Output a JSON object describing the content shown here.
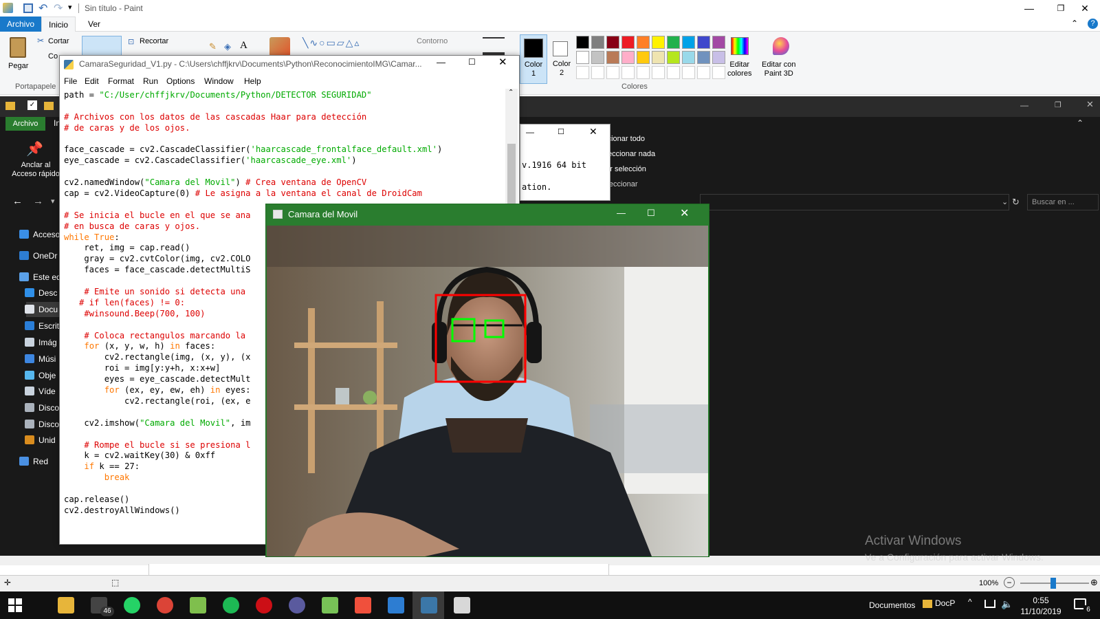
{
  "paint": {
    "title": "Sin título - Paint",
    "tabs": [
      "Archivo",
      "Inicio",
      "Ver"
    ],
    "clipboard": {
      "paste": "Pegar",
      "cut": "Cortar",
      "copy": "Co",
      "group": "Portapapele"
    },
    "image": {
      "crop": "Recortar"
    },
    "shapes": {
      "outline": "Contorno"
    },
    "color1": "Color\n1",
    "color2": "Color\n2",
    "colors_group": "Colores",
    "edit_colors": "Editar\ncolores",
    "paint3d": "Editar con\nPaint 3D",
    "palette_row1": [
      "#000000",
      "#7f7f7f",
      "#880015",
      "#ed1c24",
      "#ff7f27",
      "#fff200",
      "#22b14c",
      "#00a2e8",
      "#3f48cc",
      "#a349a4"
    ],
    "palette_row2": [
      "#ffffff",
      "#c3c3c3",
      "#b97a57",
      "#ffaec9",
      "#ffc90e",
      "#efe4b0",
      "#b5e61d",
      "#99d9ea",
      "#7092be",
      "#c8bfe7"
    ],
    "zoom": "100%"
  },
  "explorer": {
    "tab_archivo": "Archivo",
    "tab_in": "In",
    "pin_label": "Anclar al\nAcceso rápido",
    "select_all": "eccionar todo",
    "select_none": "seleccionar nada",
    "invert_selection": "ertir selección",
    "select_group": "Seleccionar",
    "search_placeholder": "Buscar en ...",
    "nav": [
      {
        "label": "Acceso",
        "color": "#3a8ee6"
      },
      {
        "label": "OneDr",
        "color": "#2d7dd2"
      },
      {
        "label": "Este eq",
        "color": "#5aa0e8"
      },
      {
        "label": "Desc",
        "color": "#2f8fe8"
      },
      {
        "label": "Docu",
        "color": "#dfe3ea"
      },
      {
        "label": "Escrit",
        "color": "#2a7ed8"
      },
      {
        "label": "Imág",
        "color": "#c9d3de"
      },
      {
        "label": "Músi",
        "color": "#3d86e0"
      },
      {
        "label": "Obje",
        "color": "#56b7ee"
      },
      {
        "label": "Víde",
        "color": "#c9d3de"
      },
      {
        "label": "Disco",
        "color": "#aab2bc"
      },
      {
        "label": "Disco",
        "color": "#aab2bc"
      },
      {
        "label": "Unid",
        "color": "#d98c1e"
      },
      {
        "label": "Red",
        "color": "#4a90e2"
      }
    ]
  },
  "python_shell": {
    "version_text": "v.1916 64 bit",
    "ation_text": "ation."
  },
  "idle": {
    "title": "CamaraSeguridad_V1.py - C:\\Users\\chffjkrv\\Documents\\Python\\ReconocimientoIMG\\Camar...",
    "menu": [
      "File",
      "Edit",
      "Format",
      "Run",
      "Options",
      "Window",
      "Help"
    ],
    "code": [
      [
        [
          "",
          "path = "
        ],
        [
          "st",
          "\"C:/User/chffjkrv/Documents/Python/DETECTOR SEGURIDAD\""
        ]
      ],
      [],
      [
        [
          "cm",
          "# Archivos con los datos de las cascadas Haar para detección"
        ]
      ],
      [
        [
          "cm",
          "# de caras y de los ojos."
        ]
      ],
      [],
      [
        [
          "",
          "face_cascade = cv2.CascadeClassifier("
        ],
        [
          "st",
          "'haarcascade_frontalface_default.xml'"
        ],
        [
          "",
          ")"
        ]
      ],
      [
        [
          "",
          "eye_cascade = cv2.CascadeClassifier("
        ],
        [
          "st",
          "'haarcascade_eye.xml'"
        ],
        [
          "",
          ")"
        ]
      ],
      [],
      [
        [
          "",
          "cv2.namedWindow("
        ],
        [
          "st",
          "\"Camara del Movil\""
        ],
        [
          "",
          ") "
        ],
        [
          "cm",
          "# Crea ventana de OpenCV"
        ]
      ],
      [
        [
          "",
          "cap = cv2.VideoCapture(0) "
        ],
        [
          "cm",
          "# Le asigna a la ventana el canal de DroidCam"
        ]
      ],
      [],
      [
        [
          "cm",
          "# Se inicia el bucle en el que se ana"
        ]
      ],
      [
        [
          "cm",
          "# en busca de caras y ojos."
        ]
      ],
      [
        [
          "kw",
          "while"
        ],
        [
          "",
          " "
        ],
        [
          "kw",
          "True"
        ],
        [
          "",
          ":"
        ]
      ],
      [
        [
          "",
          "    ret, img = cap.read()"
        ]
      ],
      [
        [
          "",
          "    gray = cv2.cvtColor(img, cv2.COLO"
        ]
      ],
      [
        [
          "",
          "    faces = face_cascade.detectMultiS"
        ]
      ],
      [],
      [
        [
          "cm",
          "    # Emite un sonido si detecta una"
        ]
      ],
      [
        [
          "cm",
          "   # if len(faces) != 0:"
        ]
      ],
      [
        [
          "cm",
          "    #winsound.Beep(700, 100)"
        ]
      ],
      [],
      [
        [
          "cm",
          "    # Coloca rectangulos marcando la"
        ]
      ],
      [
        [
          "",
          "    "
        ],
        [
          "kw",
          "for"
        ],
        [
          "",
          " (x, y, w, h) "
        ],
        [
          "kw",
          "in"
        ],
        [
          "",
          " faces:"
        ]
      ],
      [
        [
          "",
          "        cv2.rectangle(img, (x, y), (x"
        ]
      ],
      [
        [
          "",
          "        roi = img[y:y+h, x:x+w]"
        ]
      ],
      [
        [
          "",
          "        eyes = eye_cascade.detectMult"
        ]
      ],
      [
        [
          "",
          "        "
        ],
        [
          "kw",
          "for"
        ],
        [
          "",
          " (ex, ey, ew, eh) "
        ],
        [
          "kw",
          "in"
        ],
        [
          "",
          " eyes:"
        ]
      ],
      [
        [
          "",
          "            cv2.rectangle(roi, (ex, e"
        ]
      ],
      [],
      [
        [
          "",
          "    cv2.imshow("
        ],
        [
          "st",
          "\"Camara del Movil\""
        ],
        [
          "",
          ", im"
        ]
      ],
      [],
      [
        [
          "cm",
          "    # Rompe el bucle si se presiona l"
        ]
      ],
      [
        [
          "",
          "    k = cv2.waitKey(30) & 0xff"
        ]
      ],
      [
        [
          "",
          "    "
        ],
        [
          "kw",
          "if"
        ],
        [
          "",
          " k == 27:"
        ]
      ],
      [
        [
          "",
          "        "
        ],
        [
          "kw",
          "break"
        ]
      ],
      [],
      [
        [
          "",
          "cap.release()"
        ]
      ],
      [
        [
          "",
          "cv2.destroyAllWindows()"
        ]
      ]
    ]
  },
  "camera": {
    "title": "Camara del Movil"
  },
  "watermark": {
    "title": "Activar Windows",
    "subtitle": "Ve a Configuración para activar Windows."
  },
  "taskbar": {
    "mail_badge": "46",
    "folder_label": "Documentos",
    "docp_label": "DocP",
    "time": "0:55",
    "date": "11/10/2019",
    "notif_count": "6",
    "apps": [
      {
        "name": "file-explorer",
        "color": "#e7b53a"
      },
      {
        "name": "mail",
        "color": "#444444"
      },
      {
        "name": "whatsapp",
        "color": "#25d366"
      },
      {
        "name": "chrome",
        "color": "#db4437"
      },
      {
        "name": "notepad-plus",
        "color": "#7fbf4d"
      },
      {
        "name": "spotify",
        "color": "#1db954"
      },
      {
        "name": "opera",
        "color": "#cc0f16"
      },
      {
        "name": "app-circle",
        "color": "#5a5a9e"
      },
      {
        "name": "android-studio",
        "color": "#78c257"
      },
      {
        "name": "git-kraken",
        "color": "#f0503c"
      },
      {
        "name": "app-window",
        "color": "#2d7dd2"
      },
      {
        "name": "python-idle",
        "color": "#3b77a8"
      },
      {
        "name": "paint",
        "color": "#d8d8d8"
      }
    ]
  }
}
